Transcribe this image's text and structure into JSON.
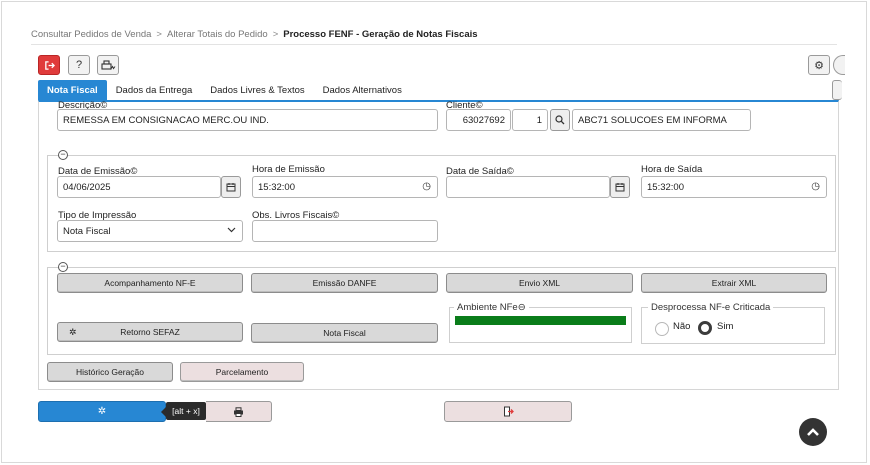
{
  "breadcrumb": {
    "items": [
      "Consultar Pedidos de Venda",
      "Alterar Totais do Pedido"
    ],
    "current": "Processo FENF - Geração de Notas Fiscais",
    "separator": ">"
  },
  "toolbar": {
    "exit_icon": "⇥",
    "help_label": "?",
    "print_icon": "🖶",
    "settings_icon": "⚙"
  },
  "tabs": [
    {
      "label": "Nota Fiscal",
      "active": true
    },
    {
      "label": "Dados da Entrega",
      "active": false
    },
    {
      "label": "Dados Livres & Textos",
      "active": false
    },
    {
      "label": "Dados Alternativos",
      "active": false
    }
  ],
  "form": {
    "descricao_label": "Descrição",
    "descricao_value": "REMESSA EM CONSIGNACAO MERC.OU IND.",
    "cliente_label": "Cliente",
    "cliente_code": "63027692",
    "cliente_seq": "1",
    "cliente_name": "ABC71 SOLUCOES EM INFORMA",
    "data_emissao_label": "Data de Emissão",
    "data_emissao_value": "04/06/2025",
    "hora_emissao_label": "Hora de Emissão",
    "hora_emissao_value": "15:32:00",
    "data_saida_label": "Data de Saída",
    "data_saida_value": "",
    "hora_saida_label": "Hora de Saída",
    "hora_saida_value": "15:32:00",
    "tipo_impressao_label": "Tipo de Impressão",
    "tipo_impressao_value": "Nota Fiscal",
    "obs_livros_label": "Obs. Livros Fiscais",
    "obs_livros_value": ""
  },
  "actions": {
    "acompanhamento": "Acompanhamento NF-E",
    "emissao_danfe": "Emissão DANFE",
    "envio_xml": "Envio XML",
    "extrair_xml": "Extrair XML",
    "retorno_sefaz": "Retorno SEFAZ",
    "nota_fiscal": "Nota Fiscal",
    "ambiente_label": "Ambiente NFe",
    "ambiente_color": "#0a7d1a",
    "desprocessa_label": "Desprocessa NF-e Criticada",
    "radio_nao": "Não",
    "radio_sim": "Sim",
    "radio_selected": "Sim"
  },
  "bottom": {
    "historico": "Histórico Geração",
    "parcelamento": "Parcelamento",
    "tooltip": "[alt + x]"
  },
  "colors": {
    "accent": "#2787d3",
    "danger": "#e03b3b"
  }
}
